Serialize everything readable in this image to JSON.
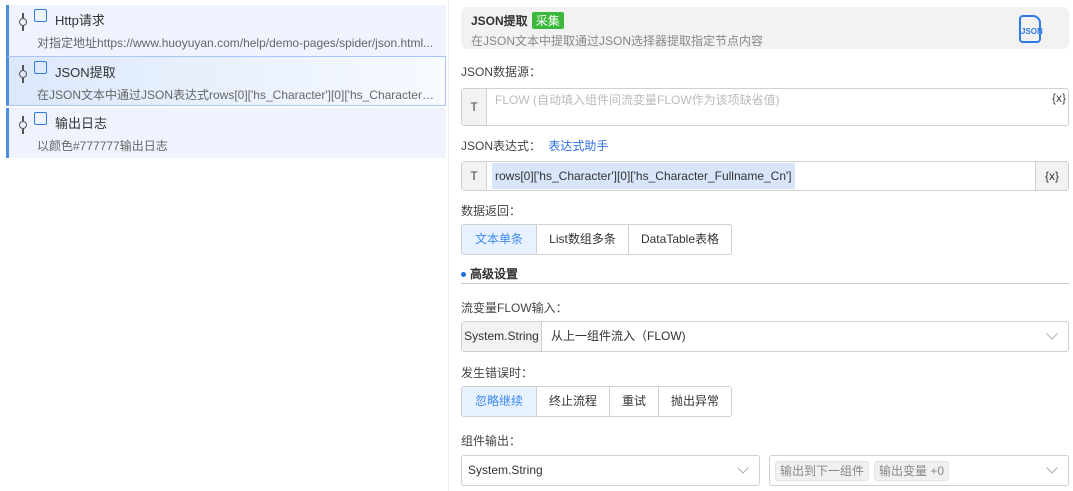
{
  "sidebar": {
    "items": [
      {
        "title": "Http请求",
        "desc": "对指定地址https://www.huoyuyan.com/help/demo-pages/spider/json.html...",
        "icon": "http-icon"
      },
      {
        "title": "JSON提取",
        "desc": "在JSON文本中通过JSON表达式rows[0]['hs_Character'][0]['hs_Character_Fullname_Cn']...",
        "icon": "json-icon",
        "selected": true
      },
      {
        "title": "输出日志",
        "desc": "以颜色#777777输出日志",
        "icon": "log-icon"
      }
    ]
  },
  "header": {
    "title": "JSON提取",
    "tag": "采集",
    "desc": "在JSON文本中提取通过JSON选择器提取指定节点内容",
    "icon_text": "JSON"
  },
  "source": {
    "label": "JSON数据源：",
    "type": "T",
    "placeholder": "FLOW (自动填入组件间流变量FLOW作为该项缺省值)",
    "var_btn": "{x}"
  },
  "expr": {
    "label": "JSON表达式：",
    "helper": "表达式助手",
    "type": "T",
    "value": "rows[0]['hs_Character'][0]['hs_Character_Fullname_Cn']",
    "var_btn": "{x}"
  },
  "ret": {
    "label": "数据返回：",
    "options": [
      "文本单条",
      "List数组多条",
      "DataTable表格"
    ],
    "selected": "文本单条"
  },
  "advanced": {
    "title": "高级设置"
  },
  "flow": {
    "label": "流变量FLOW输入：",
    "type": "System.String",
    "value": "从上一组件流入（FLOW)"
  },
  "error": {
    "label": "发生错误时：",
    "options": [
      "忽略继续",
      "终止流程",
      "重试",
      "抛出异常"
    ],
    "selected": "忽略继续"
  },
  "output": {
    "label": "组件输出：",
    "type": "System.String",
    "chips": [
      "输出到下一组件",
      "输出变量 +0"
    ]
  },
  "colors": {
    "accent": "#3b8af0",
    "tag": "#3cb93c"
  }
}
